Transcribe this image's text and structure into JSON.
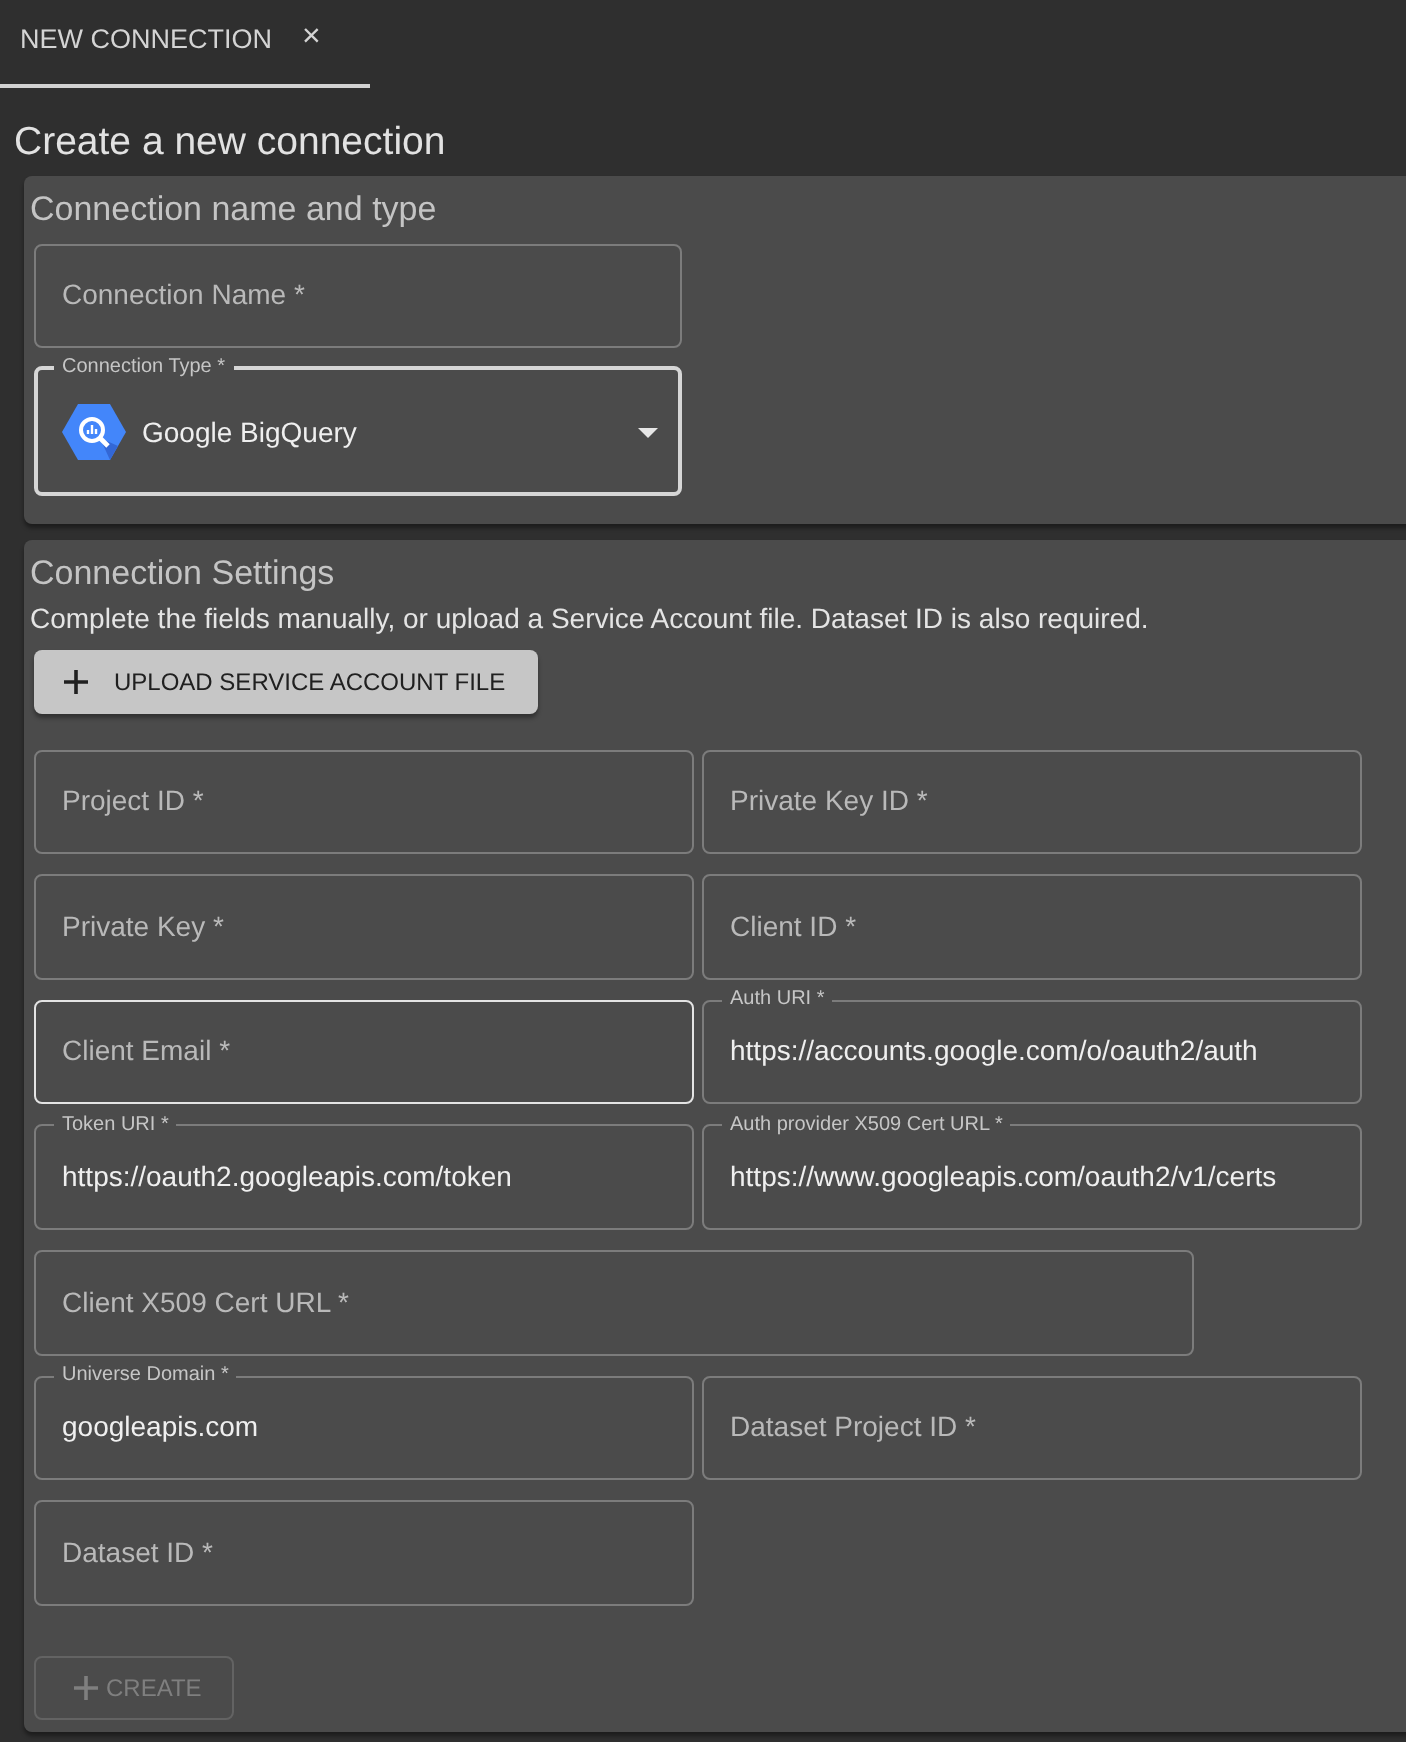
{
  "tabs": [
    {
      "label": "NEW CONNECTION",
      "close_label": "×",
      "selected": true
    }
  ],
  "title": "Create a new connection",
  "sections": [
    {
      "title": "Connection name and type",
      "rows": [
        {
          "fields": [
            {
              "kind": "text",
              "label": "Connection Name *",
              "focused": false,
              "wide": false
            }
          ]
        },
        {
          "fields": [
            {
              "kind": "select",
              "label": "Connection Type *",
              "value": "Google BigQuery",
              "focused": true,
              "wide": false
            }
          ]
        }
      ]
    },
    {
      "title": "Connection Settings",
      "description": "Complete the fields manually, or upload a Service Account file. Dataset ID is also required.",
      "upload_button": {
        "kind": "contained",
        "label": "UPLOAD SERVICE ACCOUNT FILE",
        "disabled": false
      },
      "rows": [
        {
          "fields": [
            {
              "kind": "text",
              "label": "Project ID *",
              "focused": false,
              "wide": false
            },
            {
              "kind": "text",
              "label": "Private Key ID *",
              "focused": false,
              "wide": false
            }
          ]
        },
        {
          "fields": [
            {
              "kind": "text",
              "label": "Private Key *",
              "focused": false,
              "wide": false
            },
            {
              "kind": "text",
              "label": "Client ID *",
              "focused": false,
              "wide": false
            }
          ]
        },
        {
          "fields": [
            {
              "kind": "text",
              "label": "Client Email *",
              "focused": true,
              "wide": false
            },
            {
              "kind": "text",
              "label": "Auth URI *",
              "value": "https://accounts.google.com/o/oauth2/auth",
              "focused": false,
              "wide": false
            }
          ]
        },
        {
          "fields": [
            {
              "kind": "text",
              "label": "Token URI *",
              "value": "https://oauth2.googleapis.com/token",
              "focused": false,
              "wide": false
            },
            {
              "kind": "text",
              "label": "Auth provider X509 Cert URL *",
              "value": "https://www.googleapis.com/oauth2/v1/certs",
              "focused": false,
              "wide": false
            }
          ]
        },
        {
          "fields": [
            {
              "kind": "text",
              "label": "Client X509 Cert URL *",
              "focused": false,
              "wide": true
            }
          ]
        },
        {
          "fields": [
            {
              "kind": "text",
              "label": "Universe Domain *",
              "value": "googleapis.com",
              "focused": false,
              "wide": false
            },
            {
              "kind": "text",
              "label": "Dataset Project ID *",
              "focused": false,
              "wide": false
            }
          ]
        },
        {
          "fields": [
            {
              "kind": "text",
              "label": "Dataset ID *",
              "focused": false,
              "wide": false
            }
          ]
        }
      ],
      "create_button": {
        "kind": "outlined",
        "label": "CREATE",
        "disabled": true
      }
    }
  ]
}
